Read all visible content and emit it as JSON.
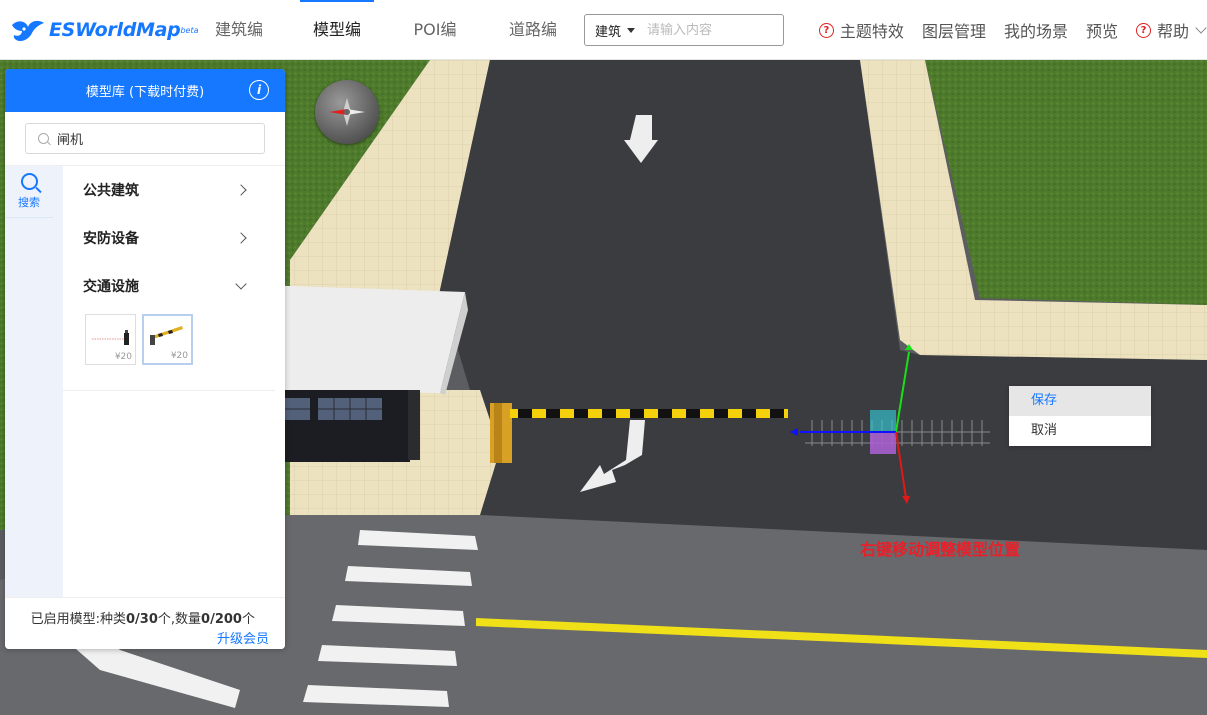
{
  "header": {
    "logo_text": "ESWorldMap",
    "logo_badge": "beta",
    "nav": [
      {
        "label": "建筑编",
        "active": false
      },
      {
        "label": "模型编",
        "active": true
      },
      {
        "label": "POI编",
        "active": false
      },
      {
        "label": "道路编",
        "active": false
      }
    ],
    "search": {
      "type": "建筑",
      "placeholder": "请输入内容",
      "value": ""
    },
    "right_menu": {
      "theme_effects": "主题特效",
      "layer_mgmt": "图层管理",
      "my_scene": "我的场景",
      "preview": "预览",
      "help": "帮助"
    }
  },
  "panel": {
    "title": "模型库 (下载时付费)",
    "search_value": "闸机",
    "side_tab": "搜索",
    "categories": [
      {
        "label": "公共建筑",
        "expanded": false
      },
      {
        "label": "安防设备",
        "expanded": false
      },
      {
        "label": "交通设施",
        "expanded": true
      }
    ],
    "models": [
      {
        "price": "¥20",
        "selected": false
      },
      {
        "price": "¥20",
        "selected": true
      }
    ],
    "footer": {
      "prefix": "已启用模型:种类",
      "kinds": "0/30",
      "middle": "个,数量",
      "count": "0/200",
      "suffix": "个",
      "upgrade": "升级会员"
    }
  },
  "context_menu": {
    "save": "保存",
    "cancel": "取消"
  },
  "hint_text": "右键移动调整模型位置",
  "colors": {
    "accent": "#1677ff",
    "hint": "#e8202a",
    "road": "#3b3c40",
    "grass": "#4e7a2c",
    "sidewalk": "#e8dcb6"
  }
}
